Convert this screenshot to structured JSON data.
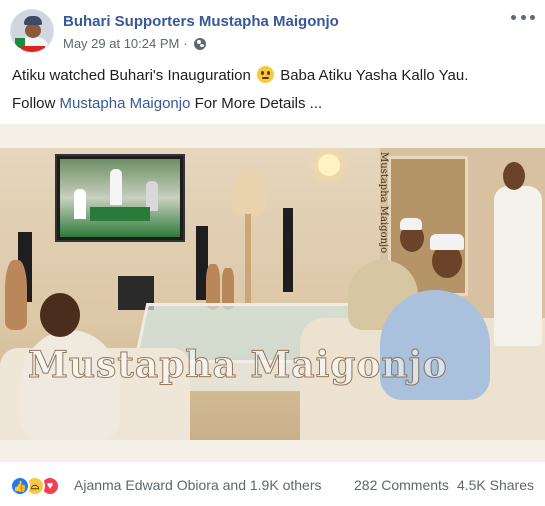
{
  "post": {
    "page_name": "Buhari Supporters Mustapha Maigonjo",
    "timestamp": "May 29 at 10:24 PM",
    "separator": "·",
    "privacy_icon": "globe-icon",
    "more_icon": "more-options-icon",
    "text_line1_a": "Atiku watched Buhari's Inauguration",
    "text_line1_emoji": "slightly-smiling-face-emoji",
    "text_line1_b": "Baba Atiku Yasha Kallo Yau.",
    "text_line2_a": "Follow",
    "text_line2_link": "Mustapha Maigonjo",
    "text_line2_b": "For More Details ..."
  },
  "photo": {
    "watermark_main": "Mustapha Maigonjo",
    "watermark_vertical": "Mustapha Maigonjo"
  },
  "footer": {
    "reactions": [
      "like-icon",
      "haha-icon",
      "love-icon"
    ],
    "reaction_names": "Ajanma Edward Obiora and 1.9K others",
    "comments": "282 Comments",
    "shares": "4.5K Shares"
  },
  "colors": {
    "link": "#385898",
    "text": "#1c1e21",
    "secondary": "#606770",
    "like": "#2078f4",
    "love": "#f33e58"
  }
}
